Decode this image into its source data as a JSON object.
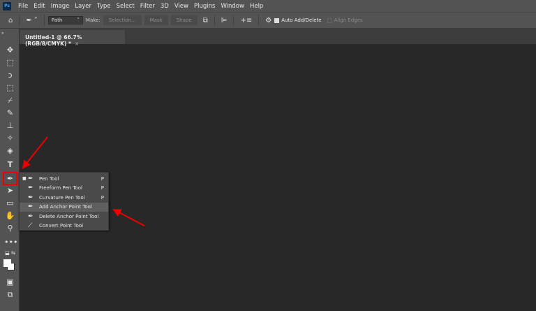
{
  "menubar": {
    "logo": "Ps",
    "items": [
      "File",
      "Edit",
      "Image",
      "Layer",
      "Type",
      "Select",
      "Filter",
      "3D",
      "View",
      "Plugins",
      "Window",
      "Help"
    ]
  },
  "options": {
    "mode": "Path",
    "make_label": "Make:",
    "selection": "Selection...",
    "mask": "Mask",
    "shape": "Shape",
    "auto_add_delete": "Auto Add/Delete",
    "auto_checked": true,
    "align_edges": "Align Edges",
    "align_checked": false
  },
  "document_tab": {
    "title": "Untitled-1 @ 66.7% (RGB/8/CMYK) *",
    "close": "×"
  },
  "flyout": {
    "items": [
      {
        "label": "Pen Tool",
        "key": "P",
        "active": true
      },
      {
        "label": "Freeform Pen Tool",
        "key": "P"
      },
      {
        "label": "Curvature Pen Tool",
        "key": "P"
      },
      {
        "label": "Add Anchor Point Tool",
        "key": "",
        "highlighted": true
      },
      {
        "label": "Delete Anchor Point Tool",
        "key": ""
      },
      {
        "label": "Convert Point Tool",
        "key": ""
      }
    ]
  },
  "annotation_color": "#e00000"
}
